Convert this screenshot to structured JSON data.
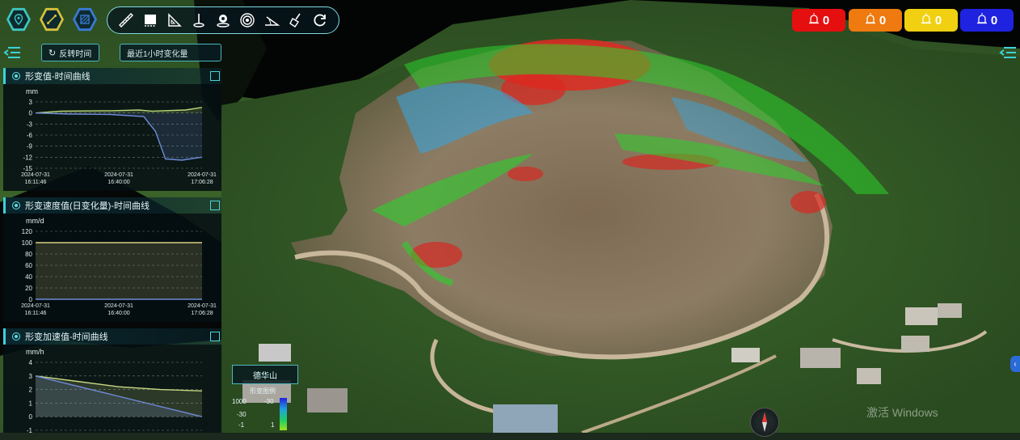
{
  "toolbar": {
    "hex_buttons": [
      {
        "name": "location-pin-icon",
        "color": "#3ec6c1"
      },
      {
        "name": "measure-line-icon",
        "color": "#d8c13a"
      },
      {
        "name": "grid-hatch-icon",
        "color": "#3a7bd8"
      }
    ],
    "tools": [
      "ruler-icon",
      "layer-square-icon",
      "triangle-ruler-icon",
      "anchor-point-icon",
      "eye-target-icon",
      "concentric-circles-icon",
      "angle-measure-icon",
      "clear-broom-icon",
      "refresh-icon"
    ]
  },
  "alarms": [
    {
      "count": "0",
      "color": "#e60f0f"
    },
    {
      "count": "0",
      "color": "#ee7a10"
    },
    {
      "count": "0",
      "color": "#f0d010"
    },
    {
      "count": "0",
      "color": "#1f23e0"
    }
  ],
  "controls": {
    "reverse_time_label": "反转时间",
    "time_range_label": "最近1小时变化量"
  },
  "panels": [
    {
      "title": "形变值-时间曲线",
      "unit": "mm",
      "y_ticks": [
        "3",
        "0",
        "-3",
        "-6",
        "-9",
        "-12",
        "-15"
      ],
      "x_ticks": [
        [
          "2024-07-31",
          "16:11:46"
        ],
        [
          "2024-07-31",
          "16:40:00"
        ],
        [
          "2024-07-31",
          "17:06:28"
        ]
      ]
    },
    {
      "title": "形变速度值(日变化量)-时间曲线",
      "unit": "mm/d",
      "y_ticks": [
        "120",
        "100",
        "80",
        "60",
        "40",
        "20",
        "0"
      ],
      "x_ticks": [
        [
          "2024-07-31",
          "16:11:46"
        ],
        [
          "2024-07-31",
          "16:40:00"
        ],
        [
          "2024-07-31",
          "17:06:28"
        ]
      ]
    },
    {
      "title": "形变加速值-时间曲线",
      "unit": "mm/h",
      "y_ticks": [
        "4",
        "3",
        "2",
        "1",
        "0",
        "-1"
      ],
      "x_ticks": []
    }
  ],
  "chart_data": [
    {
      "type": "line",
      "ylabel": "mm",
      "ylim": [
        -15,
        3
      ],
      "x": [
        "2024-07-31 16:11:46",
        "2024-07-31 16:40:00",
        "2024-07-31 17:06:28"
      ],
      "series": [
        {
          "color": "#b8d87a",
          "points": [
            [
              0,
              0
            ],
            [
              0.15,
              0.5
            ],
            [
              0.45,
              0.6
            ],
            [
              0.62,
              0.8
            ],
            [
              0.7,
              0.5
            ],
            [
              0.9,
              0.8
            ],
            [
              1,
              1.5
            ]
          ]
        },
        {
          "color": "#6f8bd8",
          "points": [
            [
              0,
              0
            ],
            [
              0.2,
              -0.3
            ],
            [
              0.45,
              -0.4
            ],
            [
              0.65,
              -1
            ],
            [
              0.72,
              -5
            ],
            [
              0.78,
              -12.5
            ],
            [
              0.88,
              -12.8
            ],
            [
              1,
              -12
            ]
          ]
        }
      ]
    },
    {
      "type": "line",
      "ylabel": "mm/d",
      "ylim": [
        0,
        120
      ],
      "x": [
        "2024-07-31 16:11:46",
        "2024-07-31 16:40:00",
        "2024-07-31 17:06:28"
      ],
      "series": [
        {
          "color": "#d8d080",
          "points": [
            [
              0,
              100
            ],
            [
              1,
              100
            ]
          ]
        },
        {
          "color": "#6f8bd8",
          "points": [
            [
              0,
              0
            ],
            [
              1,
              0
            ]
          ]
        }
      ]
    },
    {
      "type": "line",
      "ylabel": "mm/h",
      "ylim": [
        -1,
        4
      ],
      "series": [
        {
          "color": "#c8d880",
          "points": [
            [
              0,
              3
            ],
            [
              0.25,
              2.6
            ],
            [
              0.5,
              2.2
            ],
            [
              0.75,
              2.0
            ],
            [
              1,
              1.9
            ]
          ]
        },
        {
          "color": "#6f8bd8",
          "points": [
            [
              0,
              3
            ],
            [
              0.5,
              1.5
            ],
            [
              1,
              0
            ]
          ]
        }
      ]
    }
  ],
  "legend": {
    "tag": "德华山",
    "title": "形变图例",
    "values": [
      "1000",
      "-30",
      "-30",
      "-1",
      "1"
    ]
  },
  "watermark": "激活 Windows"
}
